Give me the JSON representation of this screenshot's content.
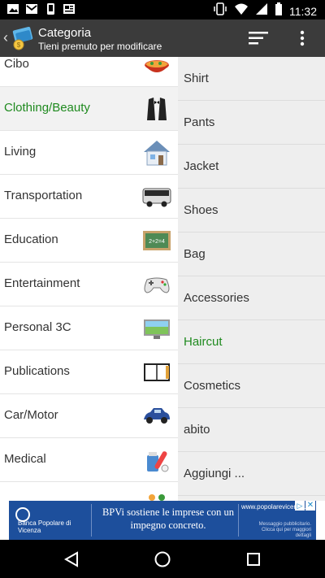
{
  "status_bar": {
    "time": "11:32",
    "left_icons": [
      "image-icon",
      "mail-icon",
      "phone-notification-icon",
      "newspaper-icon"
    ],
    "right_icons": [
      "vibrate-icon",
      "wifi-icon",
      "signal-icon",
      "battery-icon"
    ]
  },
  "action_bar": {
    "title": "Categoria",
    "subtitle": "Tieni premuto per modificare",
    "icons": [
      "back-chevron-icon",
      "app-logo-icon",
      "sort-icon",
      "overflow-menu-icon"
    ]
  },
  "categories": [
    {
      "label": "Cibo",
      "icon": "food-bowl-icon",
      "selected": false
    },
    {
      "label": "Clothing/Beauty",
      "icon": "tuxedo-icon",
      "selected": true
    },
    {
      "label": "Living",
      "icon": "house-icon",
      "selected": false
    },
    {
      "label": "Transportation",
      "icon": "bus-icon",
      "selected": false
    },
    {
      "label": "Education",
      "icon": "chalkboard-icon",
      "selected": false
    },
    {
      "label": "Entertainment",
      "icon": "gamepad-icon",
      "selected": false
    },
    {
      "label": "Personal 3C",
      "icon": "monitor-icon",
      "selected": false
    },
    {
      "label": "Publications",
      "icon": "book-icon",
      "selected": false
    },
    {
      "label": "Car/Motor",
      "icon": "car-icon",
      "selected": false
    },
    {
      "label": "Medical",
      "icon": "medicine-icon",
      "selected": false
    }
  ],
  "subcategories": [
    {
      "label": "Shirt",
      "selected": false
    },
    {
      "label": "Pants",
      "selected": false
    },
    {
      "label": "Jacket",
      "selected": false
    },
    {
      "label": "Shoes",
      "selected": false
    },
    {
      "label": "Bag",
      "selected": false
    },
    {
      "label": "Accessories",
      "selected": false
    },
    {
      "label": "Haircut",
      "selected": true
    },
    {
      "label": "Cosmetics",
      "selected": false
    },
    {
      "label": "abito",
      "selected": false
    },
    {
      "label": "Aggiungi ...",
      "selected": false
    }
  ],
  "ad": {
    "bank_name": "Banca Popolare di Vicenza",
    "message": "BPVi sostiene le imprese con un impegno concreto.",
    "url": "www.popolarevicenza.it",
    "note": "Messaggio pubblicitario. Clicca qui per maggiori dettagli",
    "info_glyph": "▷",
    "close_glyph": "✕"
  },
  "colors": {
    "accent_green": "#1f8a1f",
    "action_bar": "#3b3b3b",
    "ad_blue": "#1d4f9c"
  },
  "nav_bar": {
    "icons": [
      "back-icon",
      "home-icon",
      "recents-icon"
    ]
  }
}
